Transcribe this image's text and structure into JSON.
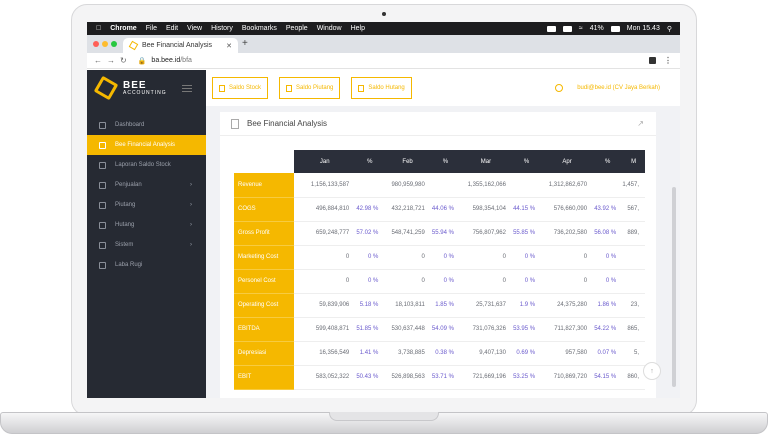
{
  "macbar": {
    "app": "Chrome",
    "menus": [
      "File",
      "Edit",
      "View",
      "History",
      "Bookmarks",
      "People",
      "Window",
      "Help"
    ],
    "battery": "41%",
    "clock": "Mon 15.43"
  },
  "browser": {
    "tab_title": "Bee Financial Analysis",
    "url_host": "ba.bee.id",
    "url_path": "/bfa"
  },
  "brand": {
    "name": "BEE",
    "sub": "ACCOUNTING"
  },
  "sidebar": {
    "items": [
      {
        "label": "Dashboard",
        "icon": "monitor-icon"
      },
      {
        "label": "Bee Financial Analysis",
        "icon": "chart-icon",
        "active": true
      },
      {
        "label": "Laporan Saldo Stock",
        "icon": "box-icon"
      },
      {
        "label": "Penjualan",
        "icon": "cart-icon",
        "chevron": true
      },
      {
        "label": "Piutang",
        "icon": "doc-icon",
        "chevron": true
      },
      {
        "label": "Hutang",
        "icon": "card-icon",
        "chevron": true
      },
      {
        "label": "Sistem",
        "icon": "gear-icon",
        "chevron": true
      },
      {
        "label": "Laba Rugi",
        "icon": "scale-icon"
      }
    ]
  },
  "topbar": {
    "buttons": [
      "Saldo Stock",
      "Saldo Piutang",
      "Saldo Hutang"
    ],
    "user": "budi@bee.id (CV Jaya Berkah)"
  },
  "card": {
    "title": "Bee Financial Analysis"
  },
  "table": {
    "headers": [
      "Jan",
      "%",
      "Feb",
      "%",
      "Mar",
      "%",
      "Apr",
      "%",
      "M"
    ],
    "rows": [
      {
        "label": "Revenue",
        "cells": [
          "1,156,133,587",
          "",
          "980,959,980",
          "",
          "1,355,162,066",
          "",
          "1,312,862,670",
          "",
          "1,457,"
        ]
      },
      {
        "label": "COGS",
        "cells": [
          "496,884,810",
          "42.98 %",
          "432,218,721",
          "44.06 %",
          "598,354,104",
          "44.15 %",
          "576,660,090",
          "43.92 %",
          "567,"
        ]
      },
      {
        "label": "Gross Profit",
        "cells": [
          "659,248,777",
          "57.02 %",
          "548,741,259",
          "55.94 %",
          "756,807,962",
          "55.85 %",
          "736,202,580",
          "56.08 %",
          "889,"
        ]
      },
      {
        "label": "Marketing Cost",
        "cells": [
          "0",
          "0 %",
          "0",
          "0 %",
          "0",
          "0 %",
          "0",
          "0 %",
          ""
        ]
      },
      {
        "label": "Personel Cost",
        "cells": [
          "0",
          "0 %",
          "0",
          "0 %",
          "0",
          "0 %",
          "0",
          "0 %",
          ""
        ]
      },
      {
        "label": "Operating Cost",
        "cells": [
          "59,839,906",
          "5.18 %",
          "18,103,811",
          "1.85 %",
          "25,731,637",
          "1.9 %",
          "24,375,280",
          "1.86 %",
          "23,"
        ]
      },
      {
        "label": "EBITDA",
        "cells": [
          "599,408,871",
          "51.85 %",
          "530,637,448",
          "54.09 %",
          "731,076,326",
          "53.95 %",
          "711,827,300",
          "54.22 %",
          "865,"
        ]
      },
      {
        "label": "Depresiasi",
        "cells": [
          "16,356,549",
          "1.41 %",
          "3,738,885",
          "0.38 %",
          "9,407,130",
          "0.69 %",
          "957,580",
          "0.07 %",
          "5,"
        ]
      },
      {
        "label": "EBIT",
        "cells": [
          "583,052,322",
          "50.43 %",
          "526,898,563",
          "53.71 %",
          "721,669,196",
          "53.25 %",
          "710,869,720",
          "54.15 %",
          "860,"
        ]
      }
    ]
  }
}
